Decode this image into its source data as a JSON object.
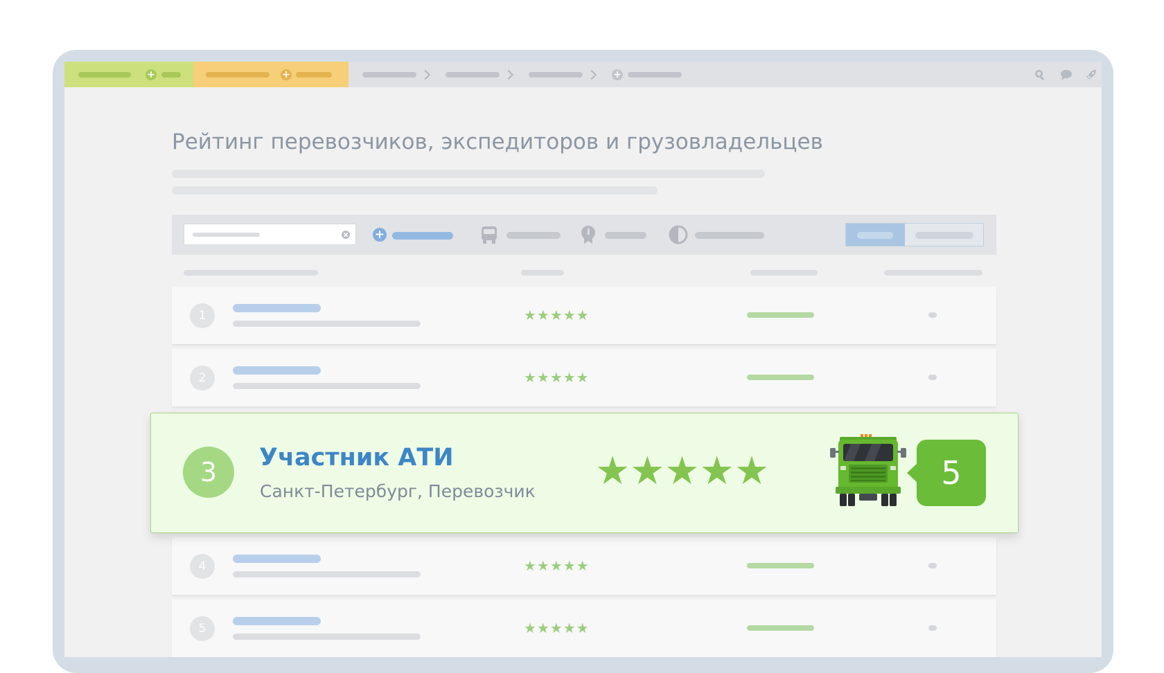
{
  "page": {
    "title": "Рейтинг перевозчиков, экспедиторов и грузовладельцев"
  },
  "rows": [
    {
      "rank": "1",
      "stars": "★★★★★"
    },
    {
      "rank": "2",
      "stars": "★★★★★"
    },
    {
      "rank": "4",
      "stars": "★★★★★"
    },
    {
      "rank": "5",
      "stars": "★★★★★"
    }
  ],
  "featured": {
    "rank": "3",
    "name": "Участник АТИ",
    "subtitle": "Санкт-Петербург, Перевозчик",
    "stars": "★★★★★",
    "score": "5"
  },
  "icons": {
    "search": "search-icon",
    "chat": "chat-icon",
    "rocket": "rocket-icon",
    "bus": "bus-icon",
    "award": "award-icon",
    "toggle": "contrast-icon",
    "truck": "truck-icon"
  },
  "colors": {
    "accent_blue": "#3d86c6",
    "success_green": "#6bbc39",
    "star_green": "#84c450",
    "featured_bg": "#eefce5"
  }
}
